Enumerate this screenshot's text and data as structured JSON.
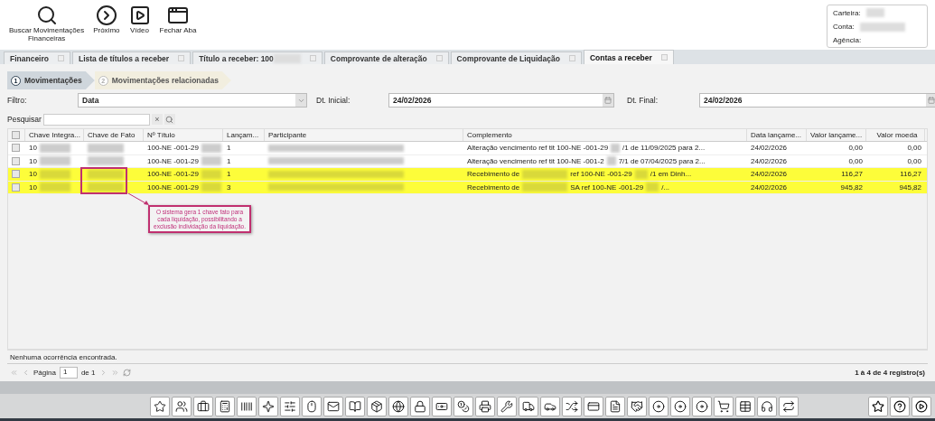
{
  "toolbar": [
    {
      "kind": "search",
      "label": "Buscar Movimentações\nFinanceiras"
    },
    {
      "kind": "next",
      "label": "Próximo"
    },
    {
      "kind": "video",
      "label": "Vídeo"
    },
    {
      "kind": "close-tab",
      "label": "Fechar Aba"
    }
  ],
  "account_info": [
    {
      "label": "Carteira:",
      "blurred": true
    },
    {
      "label": "Conta:",
      "blurred": true
    },
    {
      "label": "Agência:",
      "blurred": false
    }
  ],
  "tabs": [
    {
      "label": "Financeiro",
      "selected": false
    },
    {
      "label": "Lista de títulos a receber",
      "selected": false
    },
    {
      "label": "Título a receber: 100",
      "selected": false
    },
    {
      "label": "Comprovante de alteração",
      "selected": false
    },
    {
      "label": "Comprovante de Liquidação",
      "selected": false
    },
    {
      "label": "Contas a receber",
      "selected": true
    }
  ],
  "steps": [
    {
      "number": "1",
      "label": "Movimentações",
      "selected": true
    },
    {
      "number": "2",
      "label": "Movimentações relacionadas",
      "selected": false
    }
  ],
  "filters": {
    "filter_label": "Filtro:",
    "filter_value": "Data",
    "start_label": "Dt. Inicial:",
    "start_value": "24/02/2026",
    "end_label": "Dt. Final:",
    "end_value": "24/02/2026"
  },
  "search": {
    "label": "Pesquisar",
    "clear": "×"
  },
  "table": {
    "all_checked": false,
    "columns": [
      "Chave Integra...",
      "Chave de Fato",
      "Nº Título",
      "Lançam...",
      "Participante",
      "Complemento",
      "Data lançame...",
      "Valor lançame...",
      "Valor moeda"
    ],
    "rows": [
      {
        "checked": false,
        "highlighted": false,
        "key": "10",
        "title": "100-NE -001-29",
        "entry": "1",
        "complement": [
          "Alteração vencimento ref tit 100-NE -001-29",
          "/1 de 11/09/2025 para 2..."
        ],
        "date": "24/02/2026",
        "value": "0,00",
        "currency_value": "0,00"
      },
      {
        "checked": false,
        "highlighted": false,
        "key": "10",
        "title": "100-NE -001-29",
        "entry": "1",
        "complement": [
          "Alteração vencimento ref tit 100-NE -001-2",
          "7/1 de 07/04/2025 para 2..."
        ],
        "date": "24/02/2026",
        "value": "0,00",
        "currency_value": "0,00"
      },
      {
        "checked": false,
        "highlighted": true,
        "key": "10",
        "title": "100-NE -001-29",
        "entry": "1",
        "complement": [
          "Recebimento de",
          "ref 100-NE -001-29",
          "/1 em Dinh..."
        ],
        "date": "24/02/2026",
        "value": "116,27",
        "currency_value": "116,27"
      },
      {
        "checked": false,
        "highlighted": true,
        "key": "10",
        "title": "100-NE -001-29",
        "entry": "3",
        "complement": [
          "Recebimento de",
          "SA ref 100-NE -001-29",
          "/..."
        ],
        "date": "24/02/2026",
        "value": "945,82",
        "currency_value": "945,82"
      }
    ]
  },
  "annotation": "O sistema gera 1 chave fato para cada liquidação, possibilitando a exclusão individação da liquidação.",
  "status": "Nenhuma ocorrência encontrada.",
  "pager": {
    "page_label": "Página",
    "page": "1",
    "of": "de 1",
    "summary": "1 à 4 de 4 registro(s)"
  }
}
